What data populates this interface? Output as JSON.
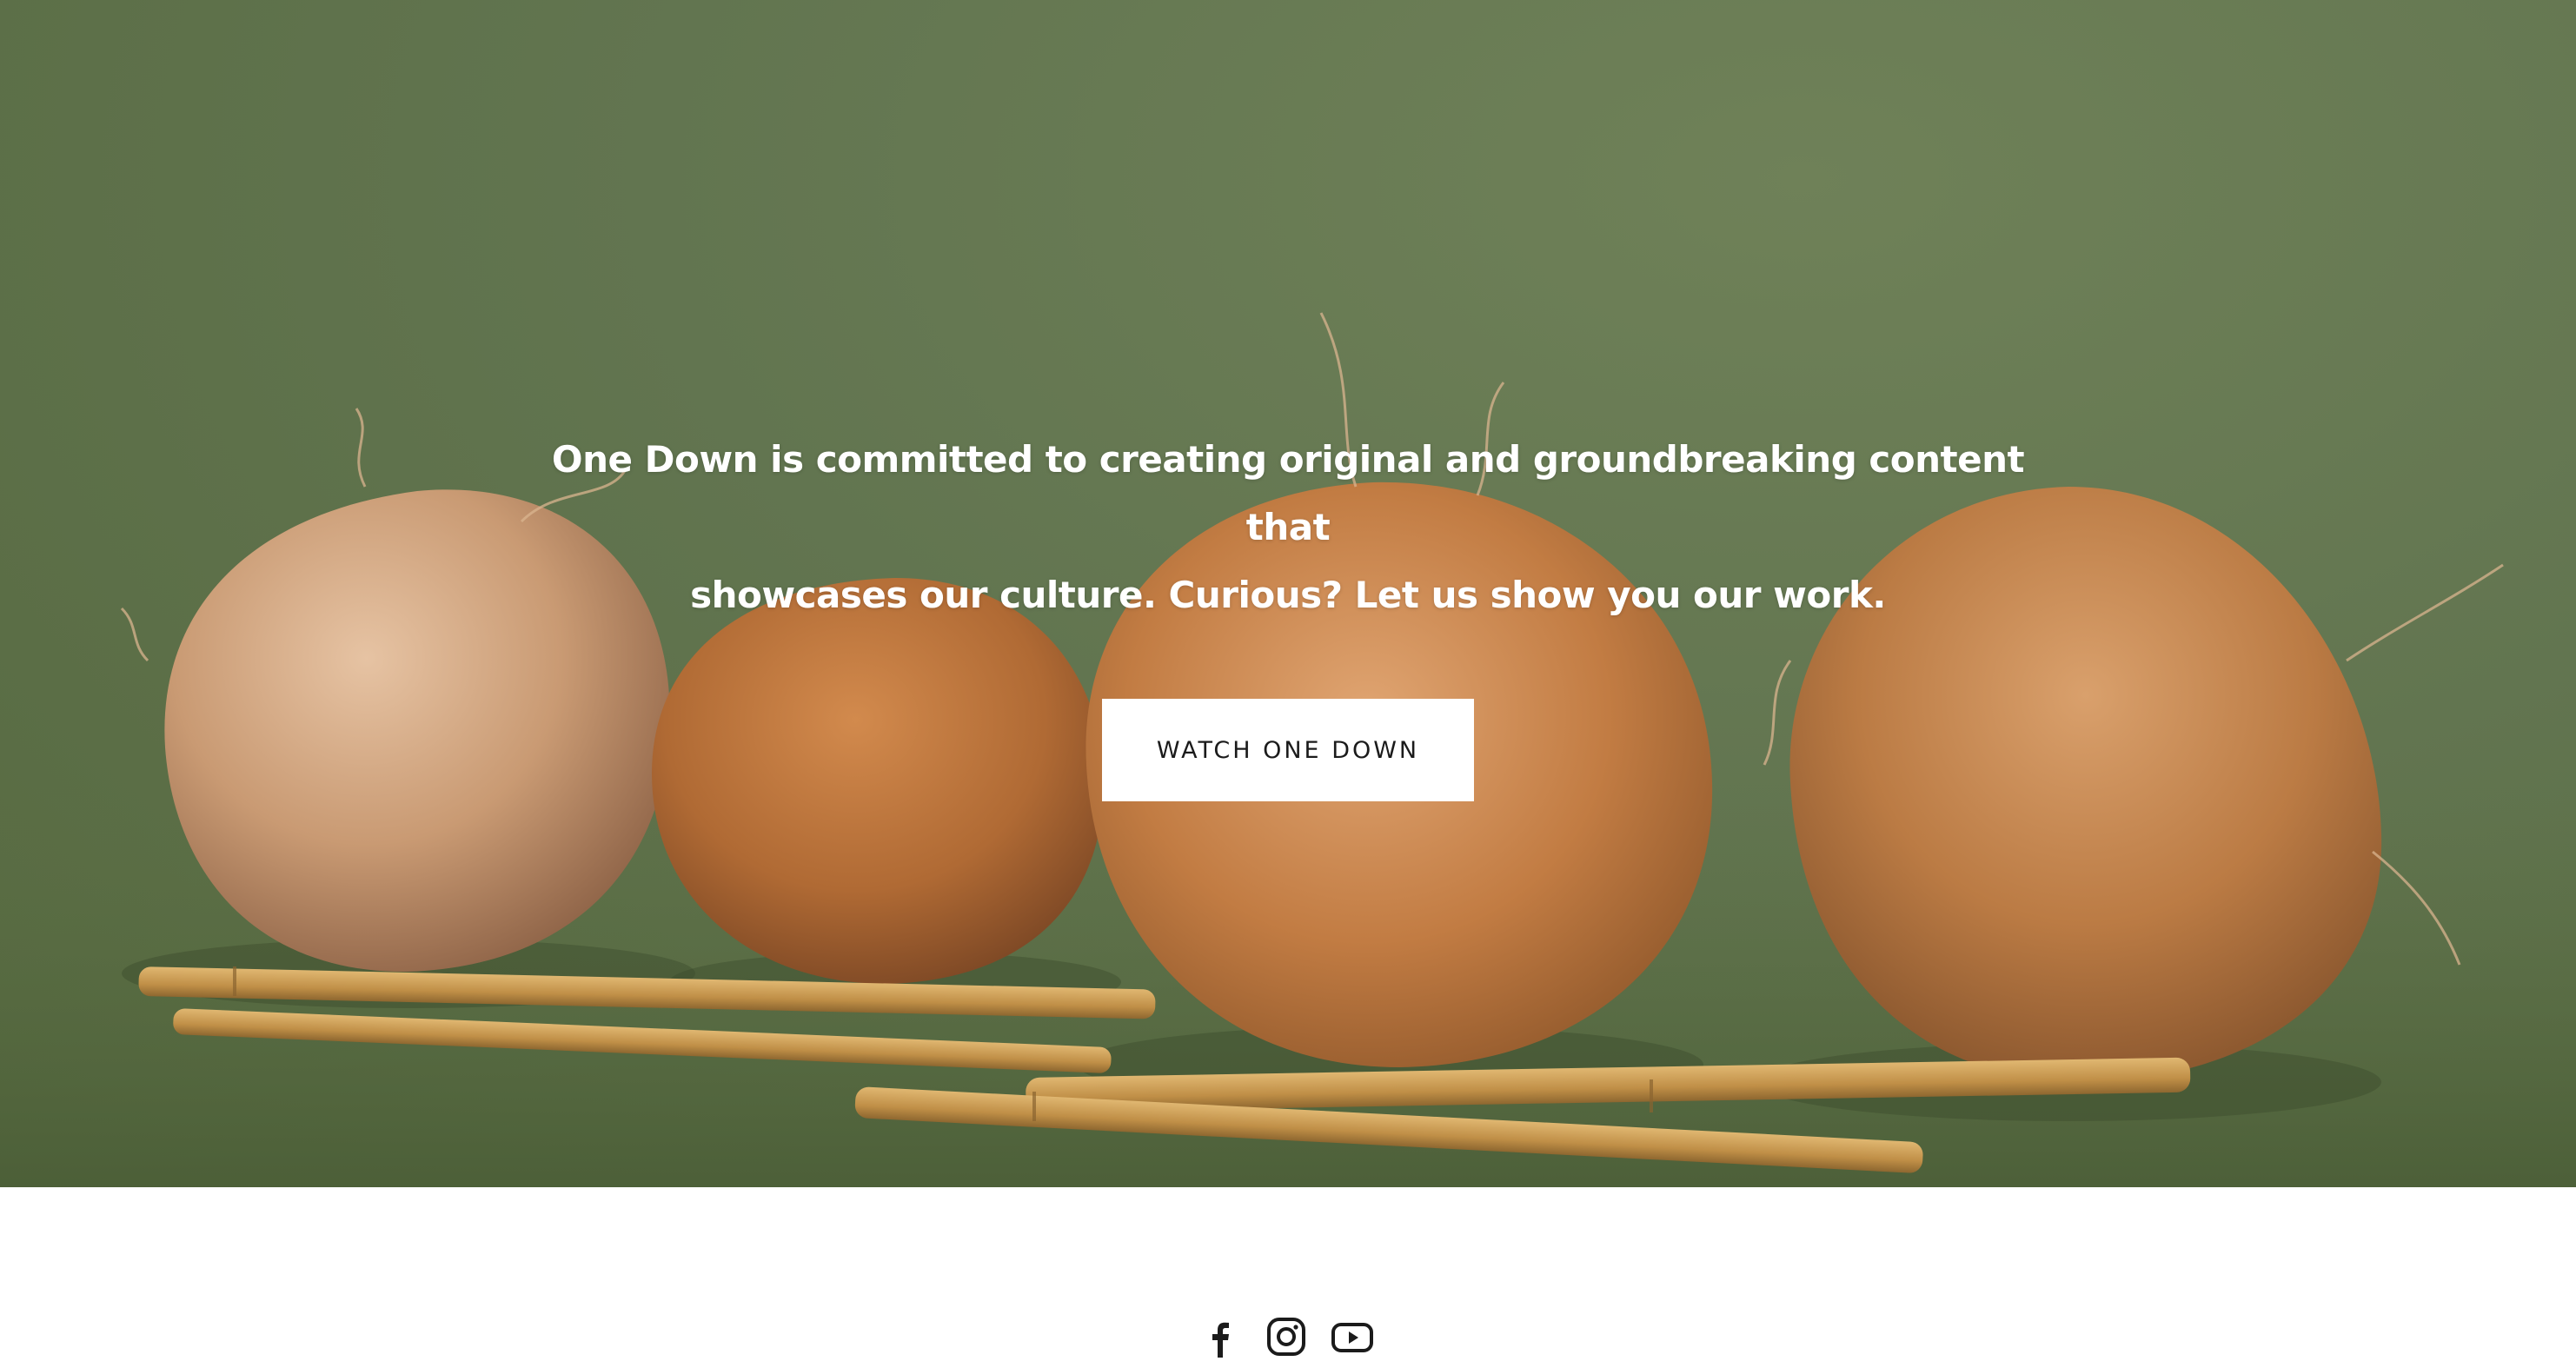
{
  "hero": {
    "text_line_1": "One Down is committed to creating original and groundbreaking content that",
    "text_line_2": "showcases our culture. Curious? Let us show you our work.",
    "button_label": "WATCH ONE DOWN"
  },
  "social": [
    {
      "icon": "facebook-icon"
    },
    {
      "icon": "instagram-icon"
    },
    {
      "icon": "youtube-icon"
    }
  ],
  "colors": {
    "hero_background": "#627550",
    "coconut": "#b9773f",
    "bamboo": "#c79a4e",
    "button_bg": "#ffffff",
    "button_text": "#1b1b1b"
  }
}
